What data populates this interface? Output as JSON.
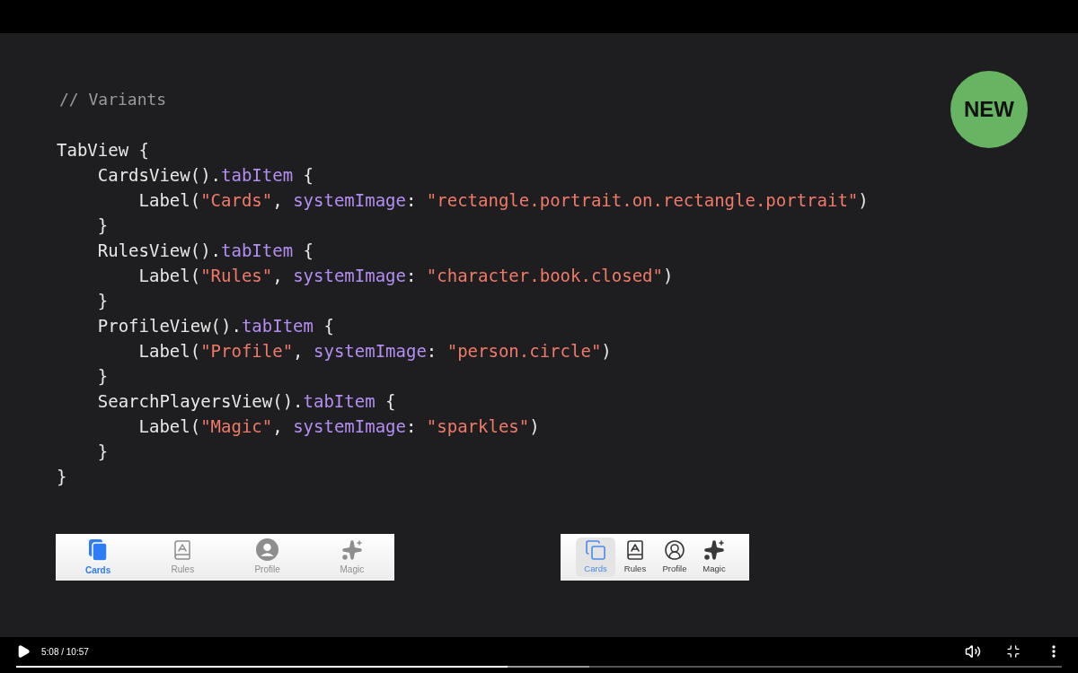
{
  "slide": {
    "comment": "// Variants",
    "badge": "NEW",
    "code_lines": [
      {
        "tokens": [
          {
            "kind": "plain",
            "text": "TabView {"
          }
        ]
      },
      {
        "tokens": [
          {
            "kind": "plain",
            "text": "    CardsView()."
          },
          {
            "kind": "method",
            "text": "tabItem"
          },
          {
            "kind": "plain",
            "text": " {"
          }
        ]
      },
      {
        "tokens": [
          {
            "kind": "plain",
            "text": "        Label("
          },
          {
            "kind": "string",
            "text": "\"Cards\""
          },
          {
            "kind": "plain",
            "text": ", "
          },
          {
            "kind": "method",
            "text": "systemImage"
          },
          {
            "kind": "plain",
            "text": ": "
          },
          {
            "kind": "string",
            "text": "\"rectangle.portrait.on.rectangle.portrait\""
          },
          {
            "kind": "plain",
            "text": ")"
          }
        ]
      },
      {
        "tokens": [
          {
            "kind": "plain",
            "text": "    }"
          }
        ]
      },
      {
        "tokens": [
          {
            "kind": "plain",
            "text": "    RulesView()."
          },
          {
            "kind": "method",
            "text": "tabItem"
          },
          {
            "kind": "plain",
            "text": " {"
          }
        ]
      },
      {
        "tokens": [
          {
            "kind": "plain",
            "text": "        Label("
          },
          {
            "kind": "string",
            "text": "\"Rules\""
          },
          {
            "kind": "plain",
            "text": ", "
          },
          {
            "kind": "method",
            "text": "systemImage"
          },
          {
            "kind": "plain",
            "text": ": "
          },
          {
            "kind": "string",
            "text": "\"character.book.closed\""
          },
          {
            "kind": "plain",
            "text": ")"
          }
        ]
      },
      {
        "tokens": [
          {
            "kind": "plain",
            "text": "    }"
          }
        ]
      },
      {
        "tokens": [
          {
            "kind": "plain",
            "text": "    ProfileView()."
          },
          {
            "kind": "method",
            "text": "tabItem"
          },
          {
            "kind": "plain",
            "text": " {"
          }
        ]
      },
      {
        "tokens": [
          {
            "kind": "plain",
            "text": "        Label("
          },
          {
            "kind": "string",
            "text": "\"Profile\""
          },
          {
            "kind": "plain",
            "text": ", "
          },
          {
            "kind": "method",
            "text": "systemImage"
          },
          {
            "kind": "plain",
            "text": ": "
          },
          {
            "kind": "string",
            "text": "\"person.circle\""
          },
          {
            "kind": "plain",
            "text": ")"
          }
        ]
      },
      {
        "tokens": [
          {
            "kind": "plain",
            "text": "    }"
          }
        ]
      },
      {
        "tokens": [
          {
            "kind": "plain",
            "text": "    SearchPlayersView()."
          },
          {
            "kind": "method",
            "text": "tabItem"
          },
          {
            "kind": "plain",
            "text": " {"
          }
        ]
      },
      {
        "tokens": [
          {
            "kind": "plain",
            "text": "        Label("
          },
          {
            "kind": "string",
            "text": "\"Magic\""
          },
          {
            "kind": "plain",
            "text": ", "
          },
          {
            "kind": "method",
            "text": "systemImage"
          },
          {
            "kind": "plain",
            "text": ": "
          },
          {
            "kind": "string",
            "text": "\"sparkles\""
          },
          {
            "kind": "plain",
            "text": ")"
          }
        ]
      },
      {
        "tokens": [
          {
            "kind": "plain",
            "text": "    }"
          }
        ]
      },
      {
        "tokens": [
          {
            "kind": "plain",
            "text": "}"
          }
        ]
      }
    ],
    "tab_bars": [
      {
        "kind": "wide",
        "items": [
          {
            "label": "Cards",
            "selected": true
          },
          {
            "label": "Rules",
            "selected": false
          },
          {
            "label": "Profile",
            "selected": false
          },
          {
            "label": "Magic",
            "selected": false
          }
        ]
      },
      {
        "kind": "compact",
        "items": [
          {
            "label": "Cards",
            "selected": true
          },
          {
            "label": "Rules",
            "selected": false
          },
          {
            "label": "Profile",
            "selected": false
          },
          {
            "label": "Magic",
            "selected": false
          }
        ]
      }
    ]
  },
  "player": {
    "time": "5:08 / 10:57",
    "progress": {
      "level": 0.47
    }
  }
}
